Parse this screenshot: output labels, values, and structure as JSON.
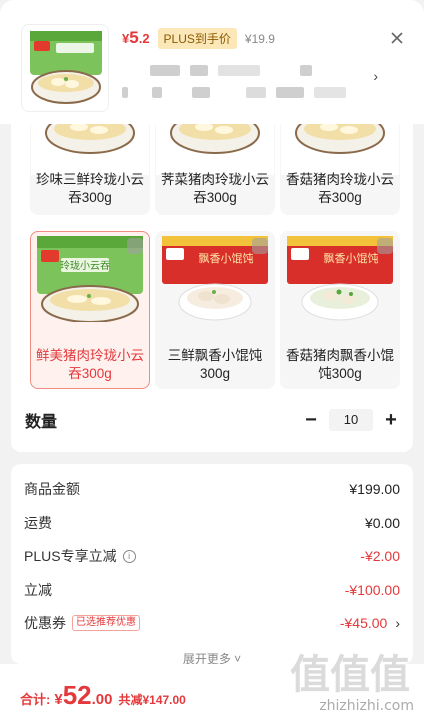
{
  "product": {
    "price_currency": "¥",
    "price_int": "5",
    "price_dec": ".2",
    "plus_tag": "PLUS到手价",
    "original_price": "¥19.9"
  },
  "options": [
    {
      "label": "珍味三鲜玲珑小云吞300g",
      "selected": false
    },
    {
      "label": "荠菜猪肉玲珑小云吞300g",
      "selected": false
    },
    {
      "label": "香菇猪肉玲珑小云吞300g",
      "selected": false
    },
    {
      "label": "鲜美猪肉玲珑小云吞300g",
      "selected": true
    },
    {
      "label": "三鲜飘香小馄饨300g",
      "selected": false
    },
    {
      "label": "香菇猪肉飘香小馄饨300g",
      "selected": false
    }
  ],
  "package_texts": {
    "yunton": "玲珑小云吞",
    "huntun": "飘香小馄饨"
  },
  "quantity": {
    "label": "数量",
    "minus": "−",
    "plus": "+",
    "value": "10"
  },
  "bill": {
    "goods_amount_label": "商品金额",
    "goods_amount": "¥199.00",
    "shipping_label": "运费",
    "shipping": "¥0.00",
    "plus_discount_label": "PLUS专享立减",
    "plus_discount": "-¥2.00",
    "instant_discount_label": "立减",
    "instant_discount": "-¥100.00",
    "coupon_label": "优惠券",
    "coupon_tag": "已选推荐优惠",
    "coupon": "-¥45.00",
    "expand_label": "展开更多"
  },
  "footer": {
    "total_label": "合计:",
    "total_currency": "¥",
    "total_int": "52",
    "total_dec": ".00",
    "saved": "共减¥147.00"
  },
  "watermark": {
    "text": "值值值",
    "url": "zhizhizhi.com"
  },
  "colors": {
    "accent": "#e4393c",
    "plus_gold": "#fbe7b8"
  }
}
